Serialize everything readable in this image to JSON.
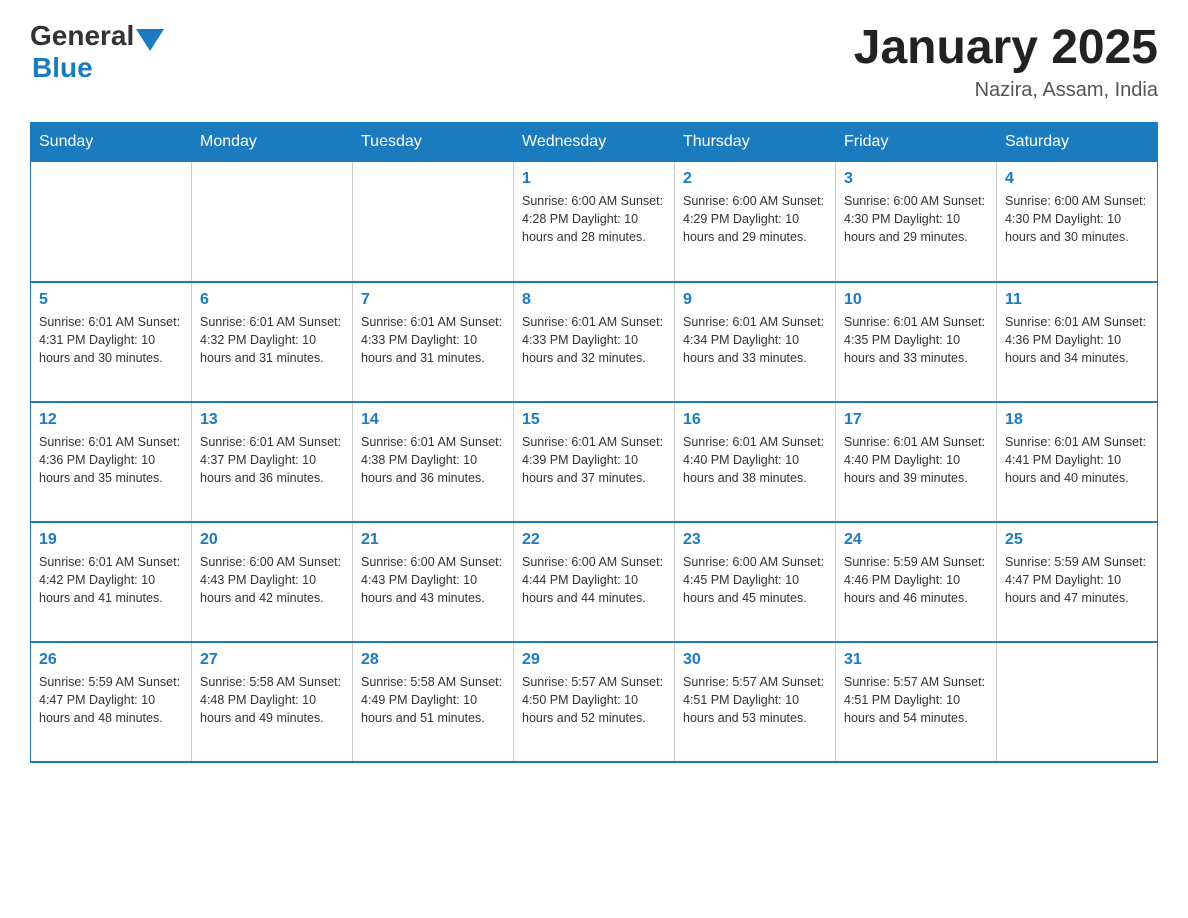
{
  "header": {
    "logo_general": "General",
    "logo_blue": "Blue",
    "title": "January 2025",
    "subtitle": "Nazira, Assam, India"
  },
  "days_of_week": [
    "Sunday",
    "Monday",
    "Tuesday",
    "Wednesday",
    "Thursday",
    "Friday",
    "Saturday"
  ],
  "weeks": [
    [
      {
        "day": "",
        "info": ""
      },
      {
        "day": "",
        "info": ""
      },
      {
        "day": "",
        "info": ""
      },
      {
        "day": "1",
        "info": "Sunrise: 6:00 AM\nSunset: 4:28 PM\nDaylight: 10 hours\nand 28 minutes."
      },
      {
        "day": "2",
        "info": "Sunrise: 6:00 AM\nSunset: 4:29 PM\nDaylight: 10 hours\nand 29 minutes."
      },
      {
        "day": "3",
        "info": "Sunrise: 6:00 AM\nSunset: 4:30 PM\nDaylight: 10 hours\nand 29 minutes."
      },
      {
        "day": "4",
        "info": "Sunrise: 6:00 AM\nSunset: 4:30 PM\nDaylight: 10 hours\nand 30 minutes."
      }
    ],
    [
      {
        "day": "5",
        "info": "Sunrise: 6:01 AM\nSunset: 4:31 PM\nDaylight: 10 hours\nand 30 minutes."
      },
      {
        "day": "6",
        "info": "Sunrise: 6:01 AM\nSunset: 4:32 PM\nDaylight: 10 hours\nand 31 minutes."
      },
      {
        "day": "7",
        "info": "Sunrise: 6:01 AM\nSunset: 4:33 PM\nDaylight: 10 hours\nand 31 minutes."
      },
      {
        "day": "8",
        "info": "Sunrise: 6:01 AM\nSunset: 4:33 PM\nDaylight: 10 hours\nand 32 minutes."
      },
      {
        "day": "9",
        "info": "Sunrise: 6:01 AM\nSunset: 4:34 PM\nDaylight: 10 hours\nand 33 minutes."
      },
      {
        "day": "10",
        "info": "Sunrise: 6:01 AM\nSunset: 4:35 PM\nDaylight: 10 hours\nand 33 minutes."
      },
      {
        "day": "11",
        "info": "Sunrise: 6:01 AM\nSunset: 4:36 PM\nDaylight: 10 hours\nand 34 minutes."
      }
    ],
    [
      {
        "day": "12",
        "info": "Sunrise: 6:01 AM\nSunset: 4:36 PM\nDaylight: 10 hours\nand 35 minutes."
      },
      {
        "day": "13",
        "info": "Sunrise: 6:01 AM\nSunset: 4:37 PM\nDaylight: 10 hours\nand 36 minutes."
      },
      {
        "day": "14",
        "info": "Sunrise: 6:01 AM\nSunset: 4:38 PM\nDaylight: 10 hours\nand 36 minutes."
      },
      {
        "day": "15",
        "info": "Sunrise: 6:01 AM\nSunset: 4:39 PM\nDaylight: 10 hours\nand 37 minutes."
      },
      {
        "day": "16",
        "info": "Sunrise: 6:01 AM\nSunset: 4:40 PM\nDaylight: 10 hours\nand 38 minutes."
      },
      {
        "day": "17",
        "info": "Sunrise: 6:01 AM\nSunset: 4:40 PM\nDaylight: 10 hours\nand 39 minutes."
      },
      {
        "day": "18",
        "info": "Sunrise: 6:01 AM\nSunset: 4:41 PM\nDaylight: 10 hours\nand 40 minutes."
      }
    ],
    [
      {
        "day": "19",
        "info": "Sunrise: 6:01 AM\nSunset: 4:42 PM\nDaylight: 10 hours\nand 41 minutes."
      },
      {
        "day": "20",
        "info": "Sunrise: 6:00 AM\nSunset: 4:43 PM\nDaylight: 10 hours\nand 42 minutes."
      },
      {
        "day": "21",
        "info": "Sunrise: 6:00 AM\nSunset: 4:43 PM\nDaylight: 10 hours\nand 43 minutes."
      },
      {
        "day": "22",
        "info": "Sunrise: 6:00 AM\nSunset: 4:44 PM\nDaylight: 10 hours\nand 44 minutes."
      },
      {
        "day": "23",
        "info": "Sunrise: 6:00 AM\nSunset: 4:45 PM\nDaylight: 10 hours\nand 45 minutes."
      },
      {
        "day": "24",
        "info": "Sunrise: 5:59 AM\nSunset: 4:46 PM\nDaylight: 10 hours\nand 46 minutes."
      },
      {
        "day": "25",
        "info": "Sunrise: 5:59 AM\nSunset: 4:47 PM\nDaylight: 10 hours\nand 47 minutes."
      }
    ],
    [
      {
        "day": "26",
        "info": "Sunrise: 5:59 AM\nSunset: 4:47 PM\nDaylight: 10 hours\nand 48 minutes."
      },
      {
        "day": "27",
        "info": "Sunrise: 5:58 AM\nSunset: 4:48 PM\nDaylight: 10 hours\nand 49 minutes."
      },
      {
        "day": "28",
        "info": "Sunrise: 5:58 AM\nSunset: 4:49 PM\nDaylight: 10 hours\nand 51 minutes."
      },
      {
        "day": "29",
        "info": "Sunrise: 5:57 AM\nSunset: 4:50 PM\nDaylight: 10 hours\nand 52 minutes."
      },
      {
        "day": "30",
        "info": "Sunrise: 5:57 AM\nSunset: 4:51 PM\nDaylight: 10 hours\nand 53 minutes."
      },
      {
        "day": "31",
        "info": "Sunrise: 5:57 AM\nSunset: 4:51 PM\nDaylight: 10 hours\nand 54 minutes."
      },
      {
        "day": "",
        "info": ""
      }
    ]
  ]
}
